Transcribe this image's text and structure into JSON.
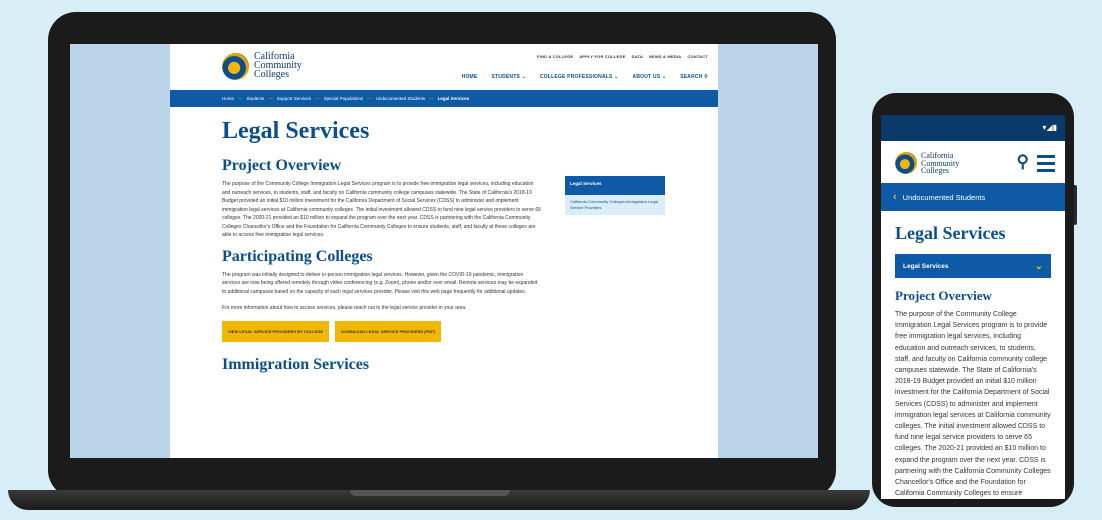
{
  "colors": {
    "brand_blue": "#0e5aa7",
    "brand_dark": "#0a3a6b",
    "accent_gold": "#f2b705"
  },
  "logo": {
    "line1": "California",
    "line2": "Community",
    "line3": "Colleges"
  },
  "utility_nav": [
    "FIND A COLLEGE",
    "APPLY FOR COLLEGE",
    "DATA",
    "NEWS & MEDIA",
    "CONTACT"
  ],
  "main_nav": [
    "HOME",
    "STUDENTS ⌄",
    "COLLEGE PROFESSIONALS ⌄",
    "ABOUT US ⌄",
    "SEARCH ⚲"
  ],
  "breadcrumb": [
    "Home",
    "Students",
    "Support Services",
    "Special Populations",
    "Undocumented Students",
    "Legal Services"
  ],
  "page": {
    "title": "Legal Services",
    "h_overview": "Project Overview",
    "overview_text": "The purpose of the Community College Immigration Legal Services program is to provide free immigration legal services, including education and outreach services, to students, staff, and faculty on California community college campuses statewide. The State of California's 2018-19 Budget provided an initial $10 million investment for the California Department of Social Services (CDSS) to administer and implement immigration legal services at California community colleges. The initial investment allowed CDSS to fund nine legal service providers to serve 65 colleges. The 2020-21 provided an $10 million to expand the program over the next year. CDSS is partnering with the California Community Colleges Chancellor's Office and the Foundation for California Community Colleges to ensure students, staff, and faculty at these colleges are able to access free immigration legal services.",
    "h_participating": "Participating Colleges",
    "participating_text": "The program was initially designed to deliver in-person immigration legal services. However, given the COVID-19 pandemic, immigration services are now being offered remotely through video conferencing (e.g. Zoom), phone and/or over email. Remote services may be expanded to additional campuses based on the capacity of each legal services provider. Please visit this web page frequently for additional updates.",
    "contact_text": "For more information about how to access services, please reach out to the legal service provider in your area.",
    "btn_by_college": "VIEW LEGAL SERVICE PROVIDERS BY COLLEGE",
    "btn_download": "DOWNLOAD LEGAL SERVICE PROVIDERS (PDF)",
    "h_immigration": "Immigration Services"
  },
  "sidebar": {
    "active": "Legal Services",
    "item": "California Community Colleges Immigration Legal Service Providers"
  },
  "mobile": {
    "back_label": "Undocumented Students",
    "title": "Legal Services",
    "dropdown": "Legal Services",
    "h_overview": "Project Overview",
    "overview_text": "The purpose of the Community College Immigration Legal Services program is to provide free immigration legal services, including education and outreach services, to students, staff, and faculty on California community college campuses statewide. The State of California's 2018-19 Budget provided an initial $10 million investment for the California Department of Social Services (CDSS) to administer and implement immigration legal services at California community colleges. The initial investment allowed CDSS to fund nine legal service providers to serve 65 colleges. The 2020-21 provided an $10 million to expand the program over the next year. CDSS is partnering with the California Community Colleges Chancellor's Office and the Foundation for California Community Colleges to ensure"
  }
}
